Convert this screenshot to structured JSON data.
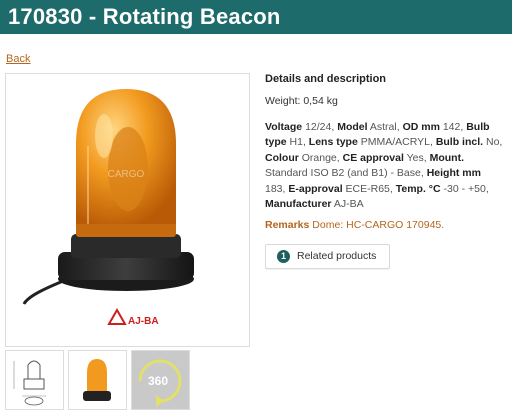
{
  "page": {
    "title": "170830 - Rotating Beacon",
    "back_label": "Back"
  },
  "photo": {
    "logo_text": "AJ-BA",
    "watermark_text": "CARGO"
  },
  "thumbnails": [
    {
      "kind": "technical-drawing"
    },
    {
      "kind": "photo"
    },
    {
      "kind": "360-view",
      "label": "360"
    }
  ],
  "details": {
    "heading": "Details and description",
    "weight_label": "Weight:",
    "weight_value": "0,54 kg",
    "specs": [
      {
        "label": "Voltage",
        "value": "12/24,"
      },
      {
        "label": "Model",
        "value": "Astral,"
      },
      {
        "label": "OD mm",
        "value": "142,"
      },
      {
        "label": "Bulb type",
        "value": "H1,"
      },
      {
        "label": "Lens type",
        "value": "PMMA/ACRYL,"
      },
      {
        "label": "Bulb incl.",
        "value": "No,"
      },
      {
        "label": "Colour",
        "value": "Orange,"
      },
      {
        "label": "CE approval",
        "value": "Yes,"
      },
      {
        "label": "Mount.",
        "value": "Standard ISO B2 (and B1) - Base,"
      },
      {
        "label": "Height mm",
        "value": "183,"
      },
      {
        "label": "E-approval",
        "value": "ECE-R65,"
      },
      {
        "label": "Temp. °C",
        "value": "-30 - +50,"
      },
      {
        "label": "Manufacturer",
        "value": "AJ-BA"
      }
    ],
    "remarks_label": "Remarks",
    "remarks_value": "Dome: HC-CARGO 170945."
  },
  "related": {
    "count": "1",
    "label": "Related products"
  },
  "colors": {
    "title_bar": "#1e6b6b",
    "link": "#b5651d",
    "badge": "#1e5f60",
    "lens": "#f29a1f"
  }
}
